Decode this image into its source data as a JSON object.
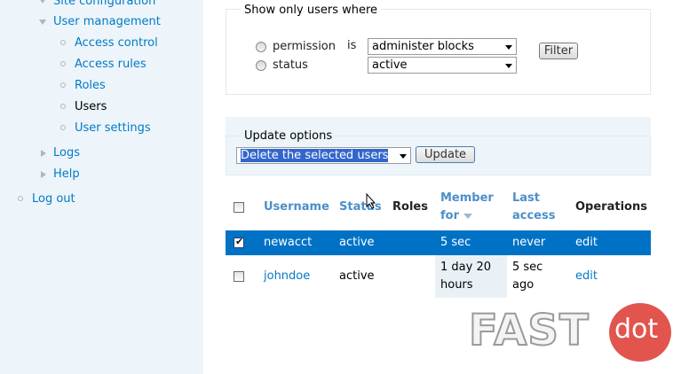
{
  "sidebar": {
    "items": [
      {
        "label": "Site configuration"
      },
      {
        "label": "User management"
      },
      {
        "label": "Access control"
      },
      {
        "label": "Access rules"
      },
      {
        "label": "Roles"
      },
      {
        "label": "Users"
      },
      {
        "label": "User settings"
      },
      {
        "label": "Logs"
      },
      {
        "label": "Help"
      },
      {
        "label": "Log out"
      }
    ]
  },
  "filter": {
    "legend": "Show only users where",
    "option_permission": "permission",
    "option_status": "status",
    "is_label": "is",
    "permission_value": "administer blocks",
    "status_value": "active",
    "button": "Filter"
  },
  "update": {
    "legend": "Update options",
    "selected_option": "Delete the selected users",
    "button": "Update"
  },
  "table": {
    "headers": {
      "username": "Username",
      "status": "Status",
      "roles": "Roles",
      "member_for_1": "Member",
      "member_for_2": "for",
      "last_access_1": "Last",
      "last_access_2": "access",
      "operations": "Operations"
    },
    "rows": [
      {
        "username": "newacct",
        "status": "active",
        "member_for": "5 sec",
        "last_access": "never",
        "operation": "edit",
        "checked": true
      },
      {
        "username": "johndoe",
        "status": "active",
        "member_for_1": "1 day 20",
        "member_for_2": "hours",
        "last_access_1": "5 sec",
        "last_access_2": "ago",
        "operation": "edit",
        "checked": false
      }
    ]
  },
  "watermark": {
    "text1": "FAST",
    "text2": "dot"
  },
  "colors": {
    "link": "#027ac6",
    "sidebar_bg": "#edf5fa",
    "selected_row": "#0072c6",
    "select_highlight": "#3366cc"
  }
}
